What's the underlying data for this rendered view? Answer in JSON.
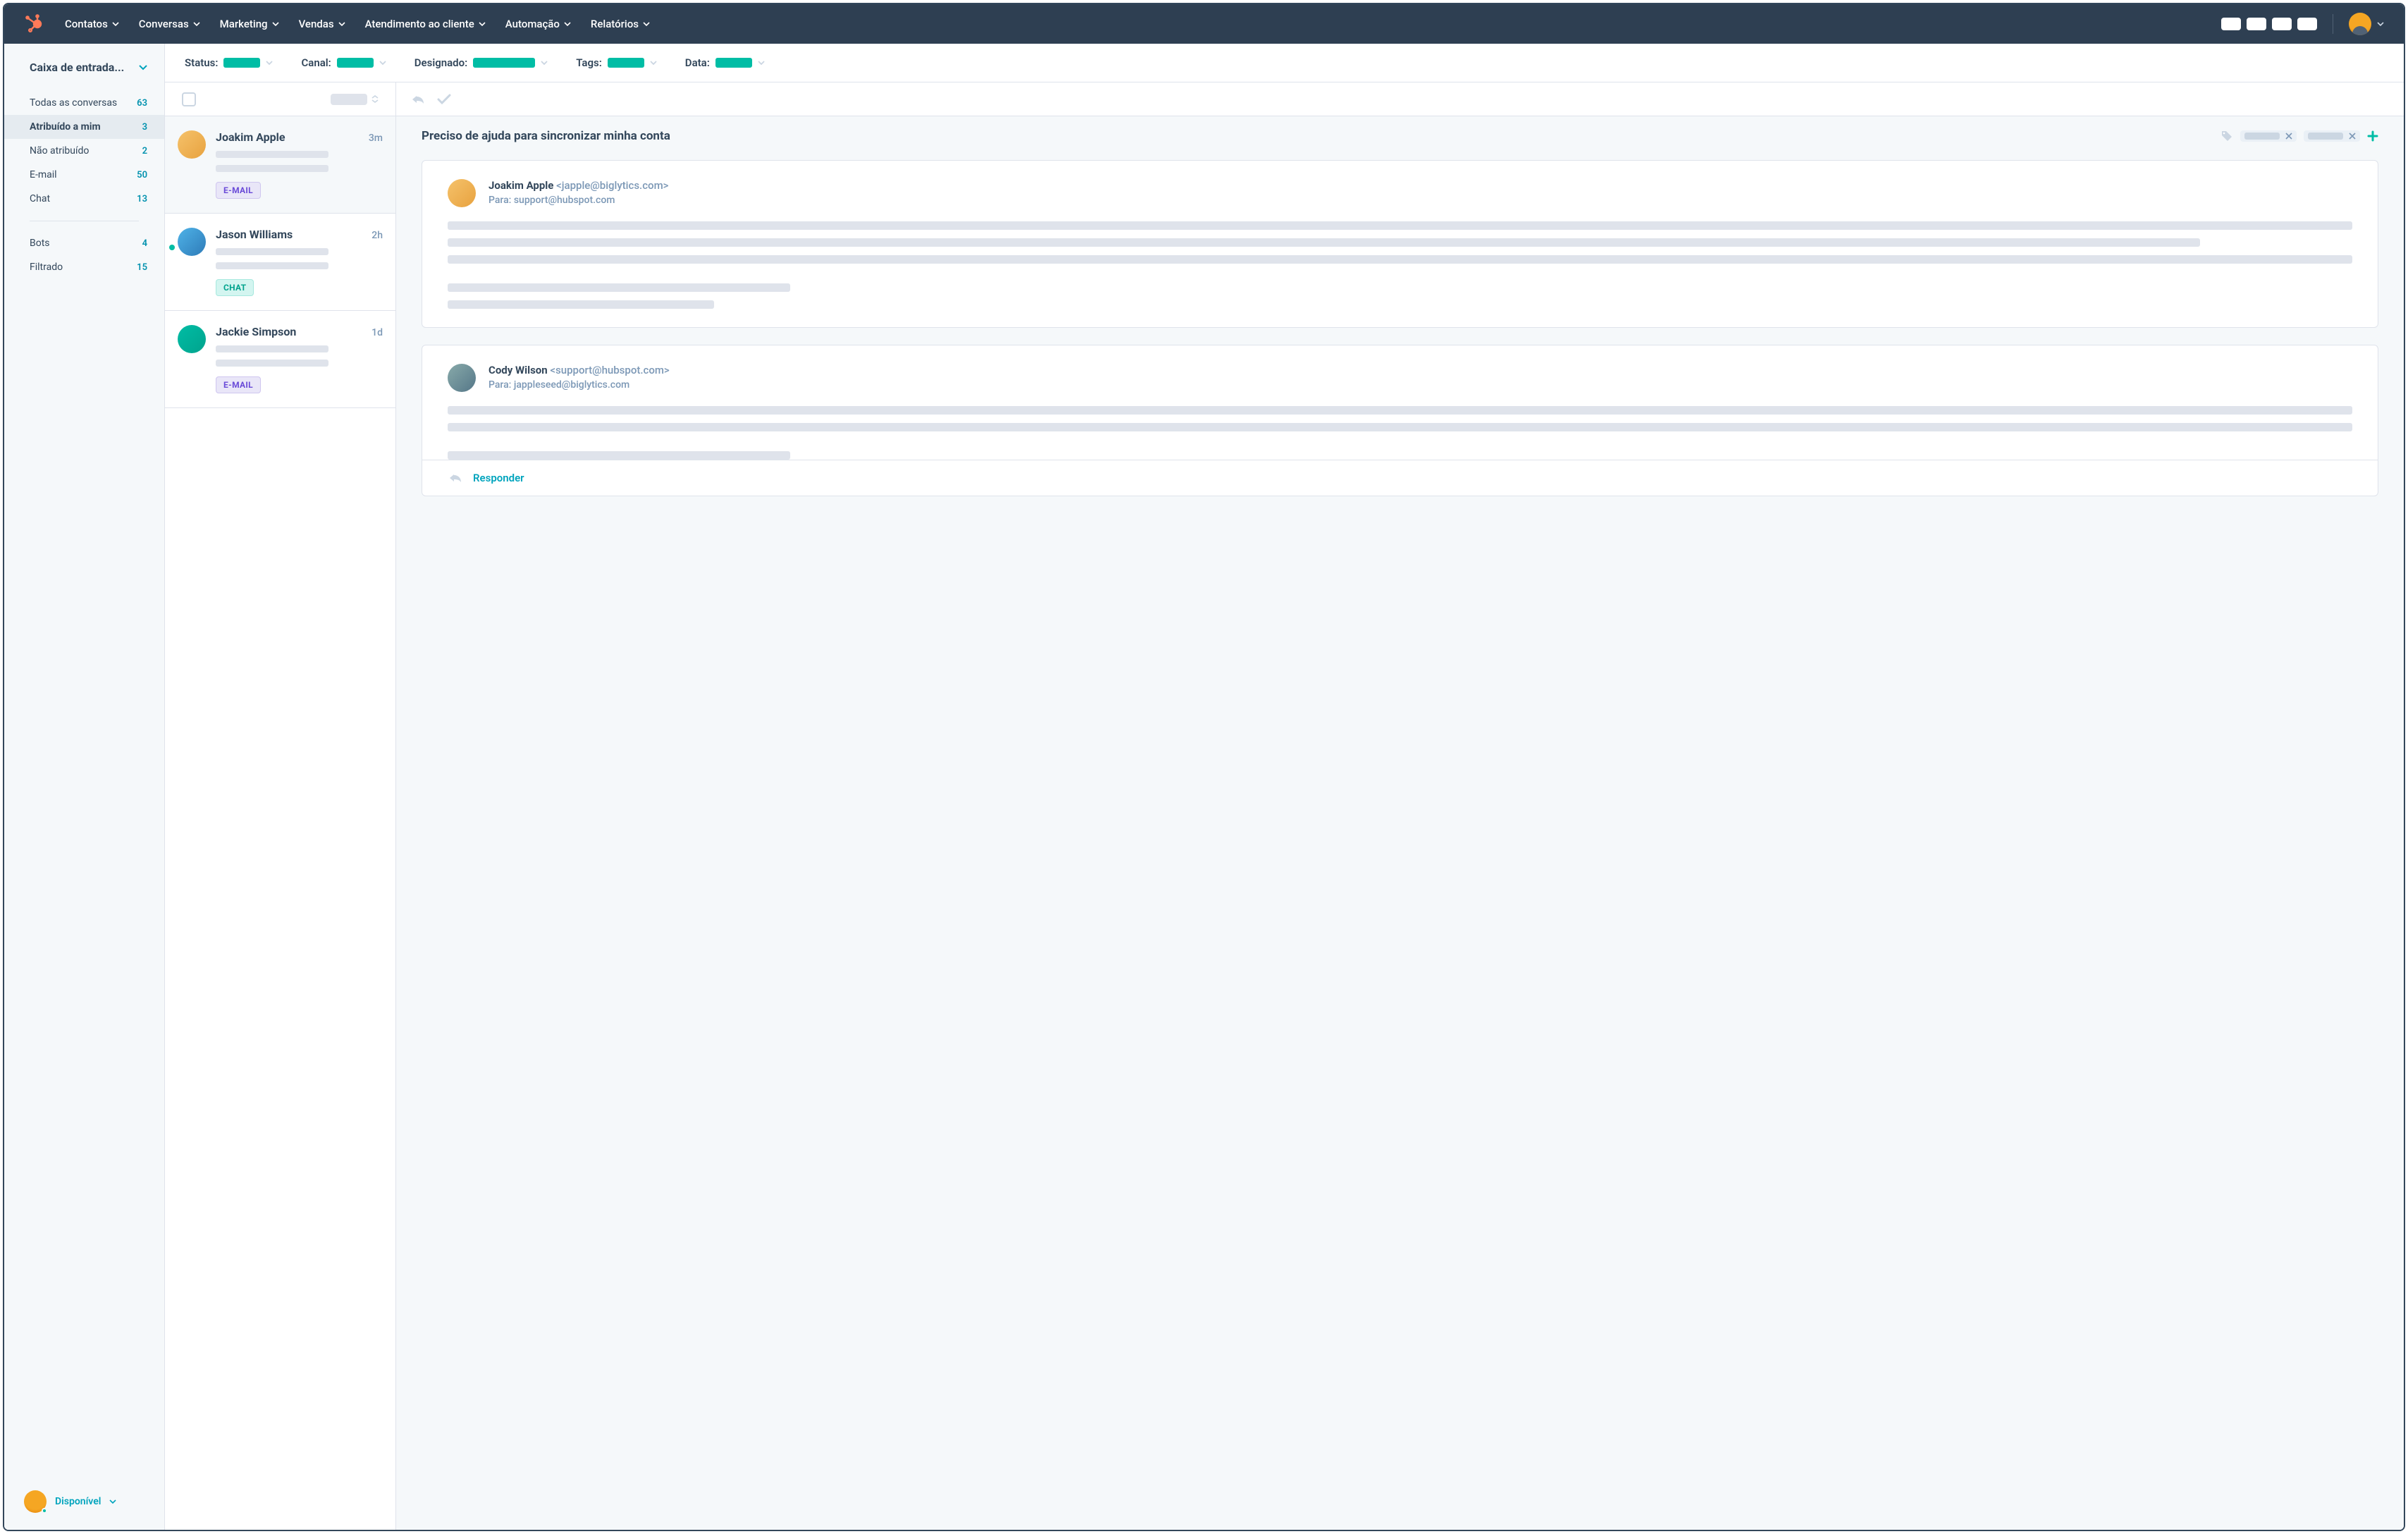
{
  "nav": {
    "items": [
      "Contatos",
      "Conversas",
      "Marketing",
      "Vendas",
      "Atendimento ao cliente",
      "Automação",
      "Relatórios"
    ]
  },
  "sidebar": {
    "title": "Caixa de entrada...",
    "groups": {
      "main": [
        {
          "label": "Todas as conversas",
          "count": "63"
        },
        {
          "label": "Atribuído a mim",
          "count": "3"
        },
        {
          "label": "Não atribuído",
          "count": "2"
        },
        {
          "label": "E-mail",
          "count": "50"
        },
        {
          "label": "Chat",
          "count": "13"
        }
      ],
      "other": [
        {
          "label": "Bots",
          "count": "4"
        },
        {
          "label": "Filtrado",
          "count": "15"
        }
      ]
    },
    "activeIndex": 1,
    "status": "Disponível"
  },
  "filters": {
    "status": "Status:",
    "canal": "Canal:",
    "designado": "Designado:",
    "tags": "Tags:",
    "data": "Data:"
  },
  "threads": [
    {
      "name": "Joakim Apple",
      "time": "3m",
      "badge": "E-MAIL",
      "badgeType": "email",
      "selected": true,
      "unread": false
    },
    {
      "name": "Jason Williams",
      "time": "2h",
      "badge": "CHAT",
      "badgeType": "chat",
      "selected": false,
      "unread": true
    },
    {
      "name": "Jackie Simpson",
      "time": "1d",
      "badge": "E-MAIL",
      "badgeType": "email",
      "selected": false,
      "unread": false
    }
  ],
  "detail": {
    "subject": "Preciso de ajuda para sincronizar minha conta",
    "messages": [
      {
        "fromName": "Joakim Apple",
        "fromAddr": "<japple@biglytics.com>",
        "toLabel": "Para: support@hubspot.com"
      },
      {
        "fromName": "Cody Wilson",
        "fromAddr": "<support@hubspot.com>",
        "toLabel": "Para: jappleseed@biglytics.com"
      }
    ],
    "replyLabel": "Responder"
  },
  "colors": {
    "teal": "#00bda5",
    "darknav": "#2e3f52",
    "cyan": "#00a4bd",
    "grey": "#cbd6e2"
  }
}
